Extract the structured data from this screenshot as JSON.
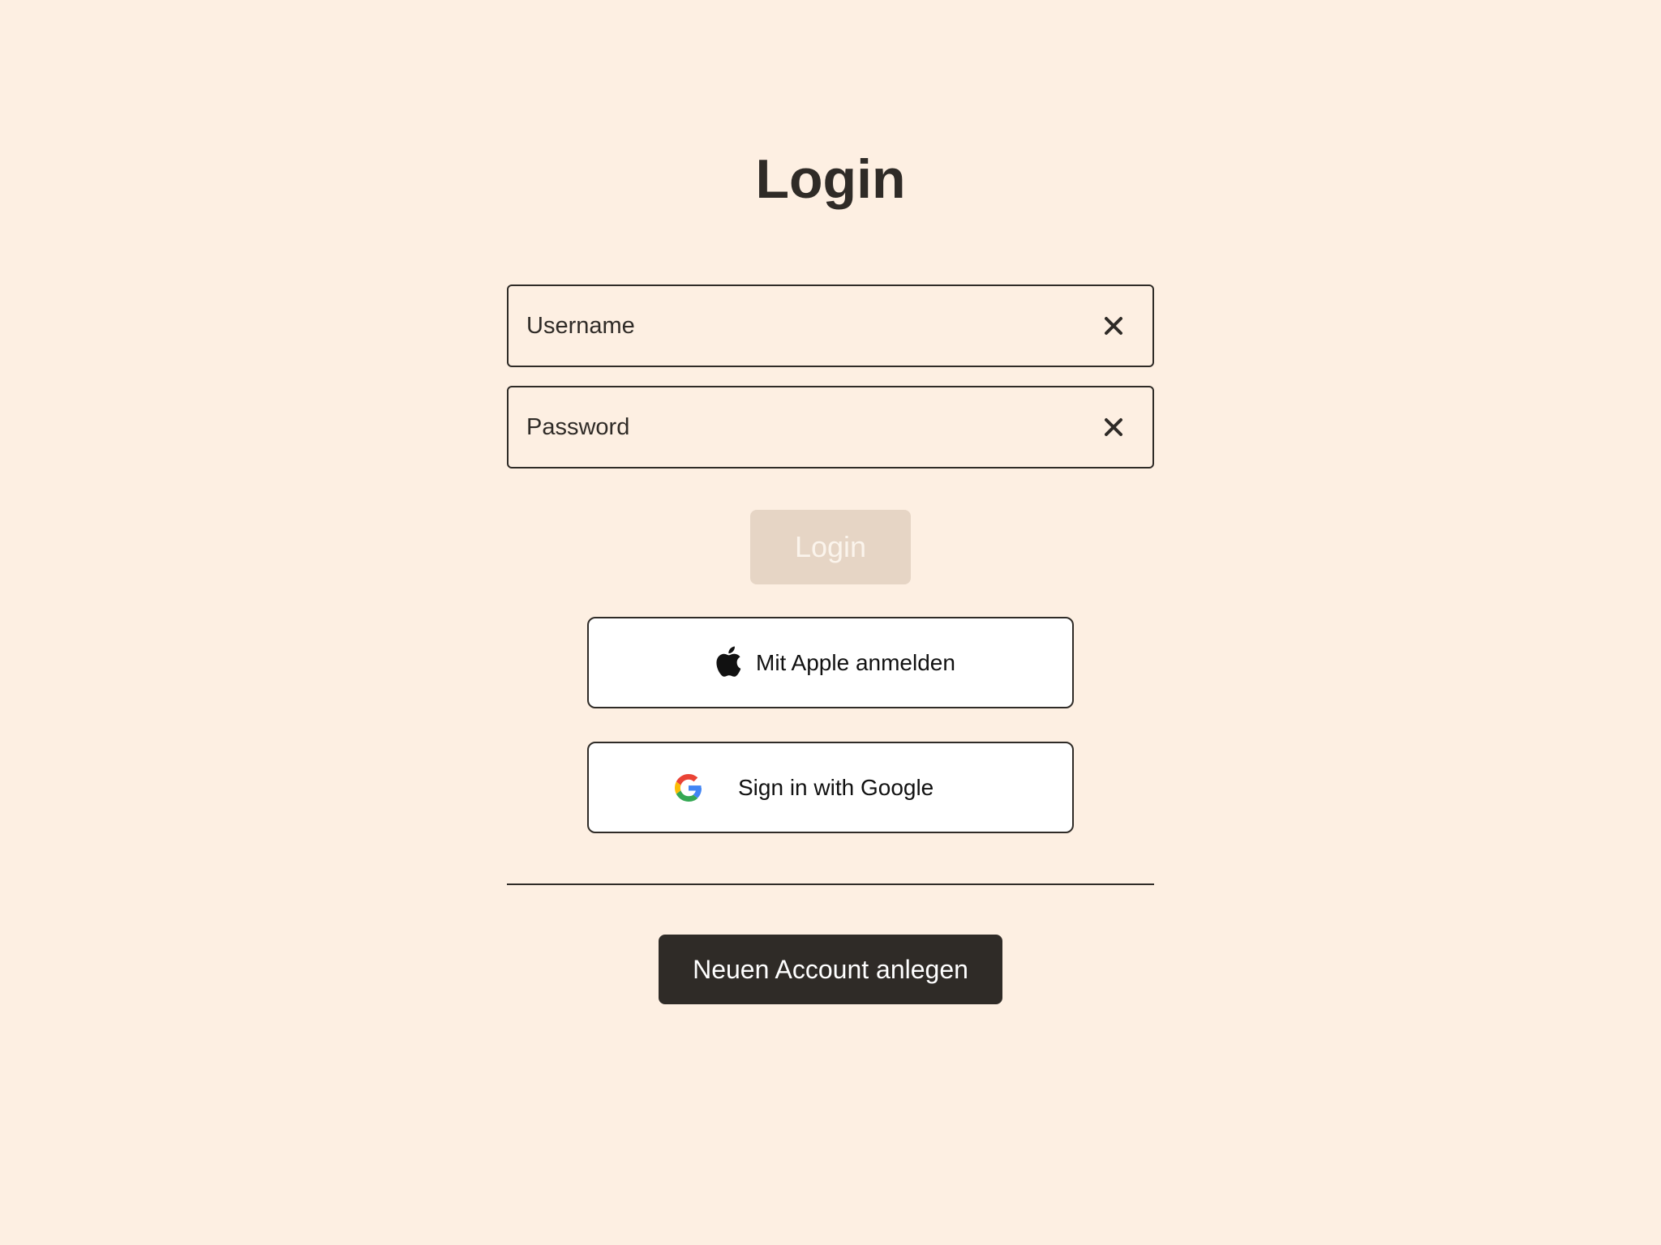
{
  "title": "Login",
  "fields": {
    "username": {
      "placeholder": "Username",
      "value": ""
    },
    "password": {
      "placeholder": "Password",
      "value": ""
    }
  },
  "buttons": {
    "login": "Login",
    "apple": "Mit Apple anmelden",
    "google": "Sign in with Google",
    "create_account": "Neuen Account anlegen"
  },
  "icons": {
    "clear": "close-icon",
    "apple": "apple-logo-icon",
    "google": "google-logo-icon"
  },
  "colors": {
    "background": "#fdefe2",
    "text": "#2f2b27",
    "login_disabled_bg": "#e6d5c5",
    "login_disabled_text": "#fbf4ec",
    "primary_dark": "#2f2b27",
    "sso_bg": "#ffffff"
  },
  "state": {
    "login_enabled": false
  }
}
